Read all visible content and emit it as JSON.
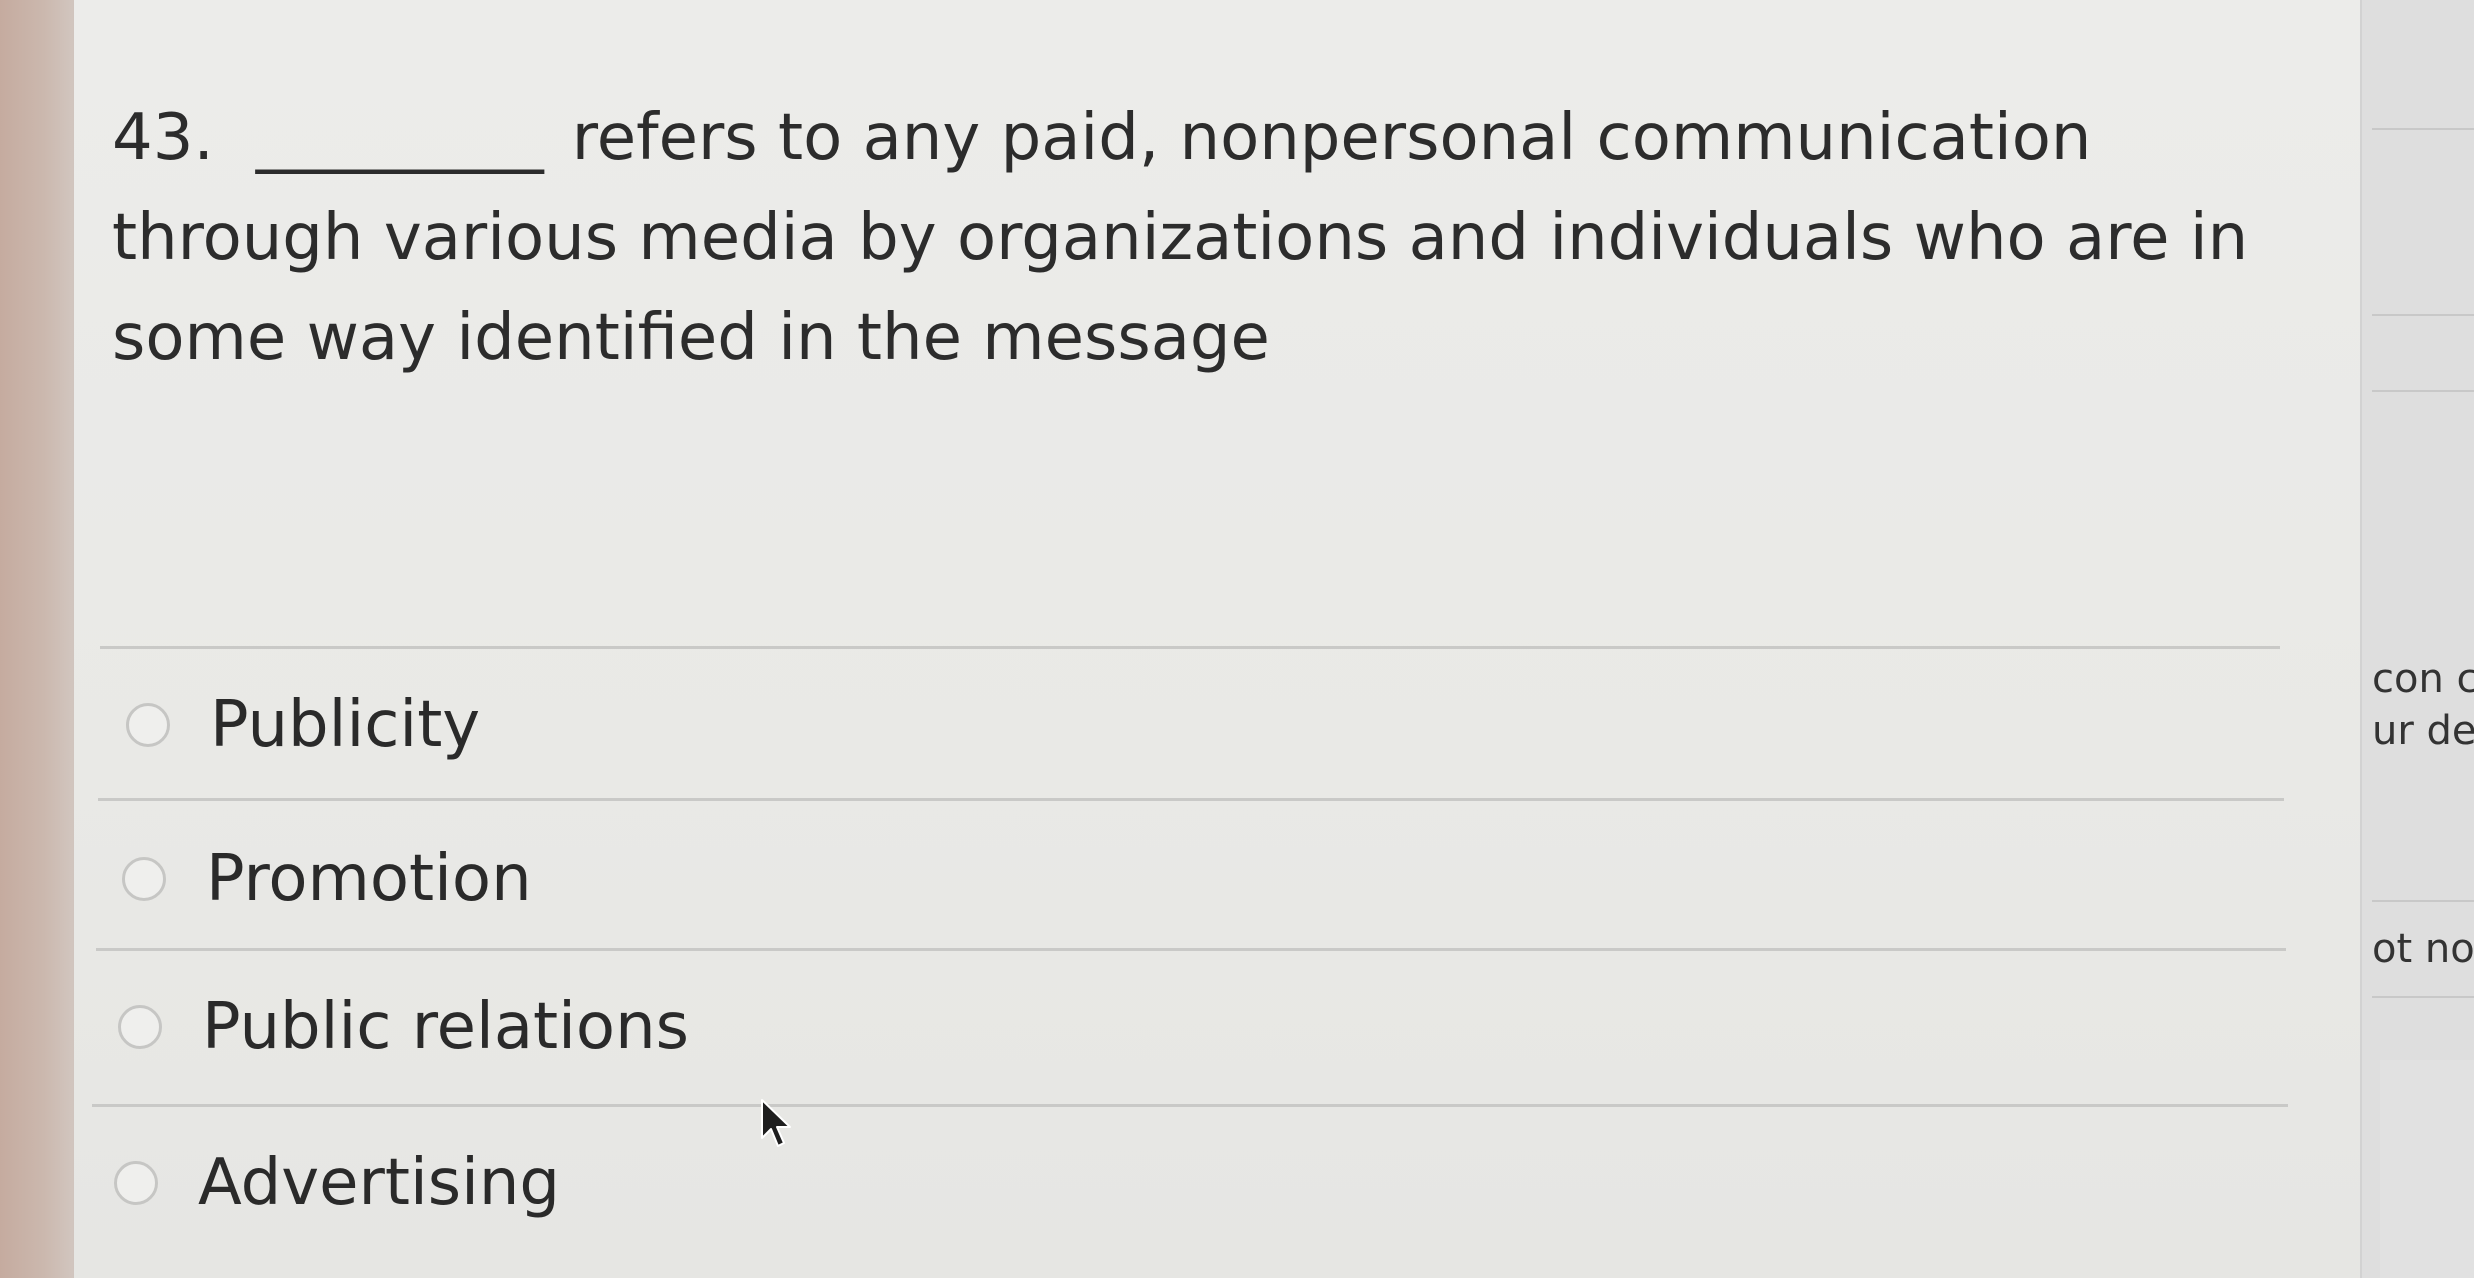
{
  "question": {
    "number": "43.",
    "blank": "_________",
    "text": "refers to any paid, nonpersonal communication through various media by organizations and individuals who are in some way identified in the message"
  },
  "options": [
    {
      "label": "Publicity",
      "selected": false
    },
    {
      "label": "Promotion",
      "selected": false
    },
    {
      "label": "Public relations",
      "selected": false
    },
    {
      "label": "Advertising",
      "selected": false
    }
  ],
  "side_panel": {
    "line1": "con c",
    "line2": "ur dev",
    "line3": "ot no"
  },
  "colors": {
    "panel_background": "#ececea",
    "text": "#2c2c2c",
    "divider": "#c9c9c7"
  },
  "icons": {
    "radio": "radio-circle-icon",
    "cursor": "mouse-pointer-icon"
  }
}
